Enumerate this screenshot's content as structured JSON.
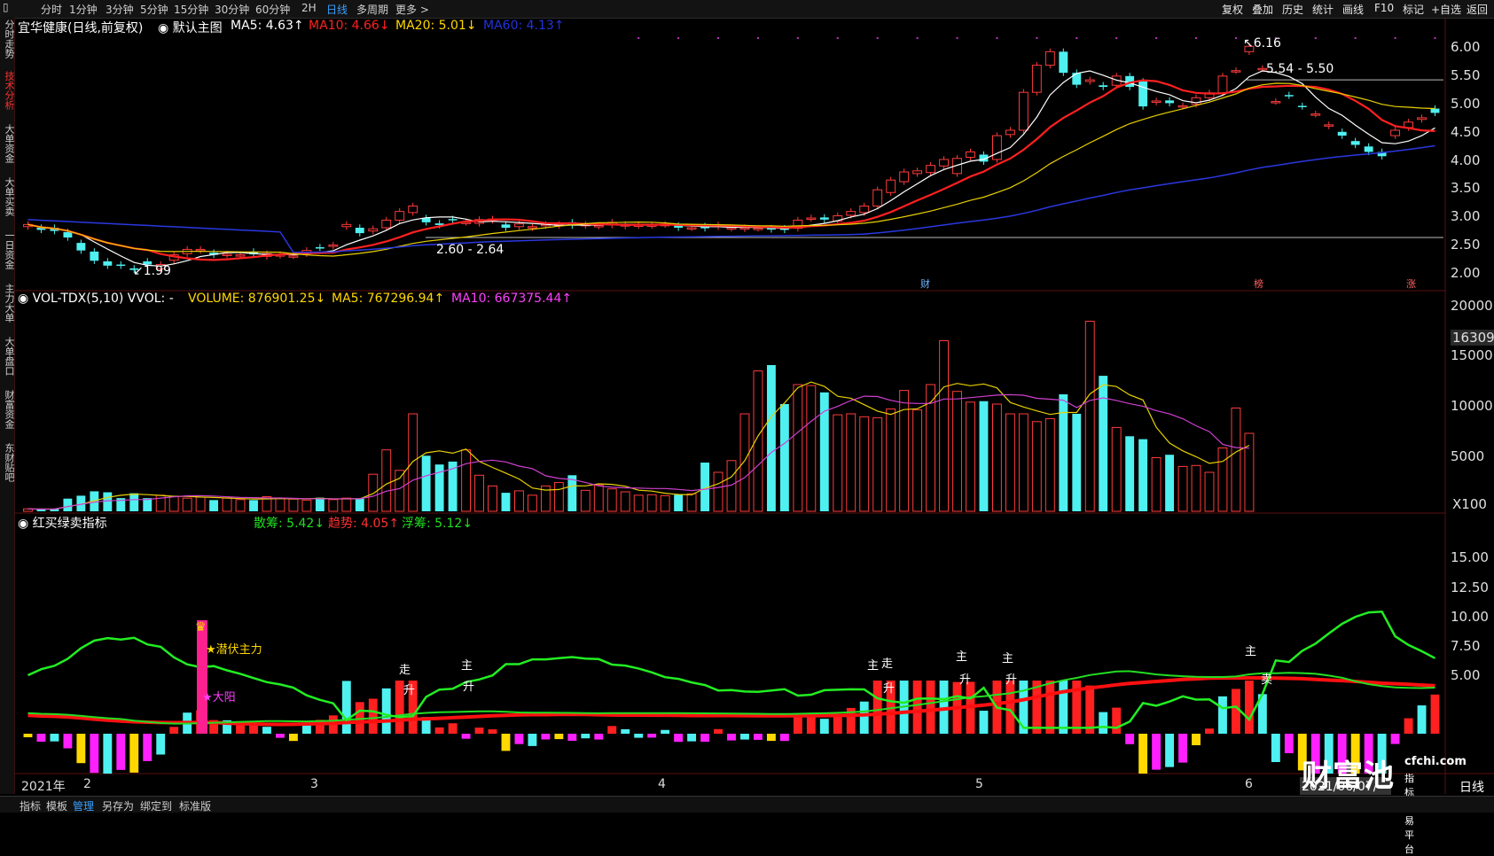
{
  "toolbar": {
    "items": [
      "分时",
      "1分钟",
      "3分钟",
      "5分钟",
      "15分钟",
      "30分钟",
      "60分钟",
      "2H",
      "日线",
      "多周期",
      "更多 >"
    ],
    "active": "日线",
    "right_items": [
      "复权",
      "叠加",
      "历史",
      "统计",
      "画线",
      "F10",
      "标记",
      "+自选",
      "返回"
    ]
  },
  "sidebar": {
    "items": [
      "分时走势",
      "技术分析",
      "大单资金",
      "大单买卖",
      "一日资金",
      "主力大单",
      "大单盘口",
      "财富资金",
      "东财贴吧"
    ],
    "active": "技术分析"
  },
  "main_panel": {
    "stock_name": "宜华健康(日线,前复权)",
    "template_label": "默认主图",
    "indicators": [
      {
        "label": "MA5: 4.63↑",
        "color": "#ffffff"
      },
      {
        "label": "MA10: 4.66↓",
        "color": "#ff2020"
      },
      {
        "label": "MA20: 5.01↓",
        "color": "#ffd800"
      },
      {
        "label": "MA60: 4.13↑",
        "color": "#2233dd"
      }
    ],
    "annotations": {
      "high": "6.16",
      "low": "1.99",
      "range_high": "5.54 - 5.50",
      "range_low": "2.60 - 2.64"
    },
    "events": [
      "财",
      "榜",
      "涨"
    ],
    "yticks": [
      "6.00",
      "5.50",
      "5.00",
      "4.50",
      "4.00",
      "3.50",
      "3.00",
      "2.50",
      "2.00"
    ]
  },
  "volume_panel": {
    "title": "VOL-TDX(5,10) VVOL: -",
    "indicators": [
      {
        "label": "VOLUME: 876901.25↓",
        "color": "#ffd800"
      },
      {
        "label": "MA5: 767296.94↑",
        "color": "#ffd800"
      },
      {
        "label": "MA10: 667375.44↑",
        "color": "#ff40ff"
      }
    ],
    "yticks": [
      "20000",
      "15000",
      "10000",
      "5000"
    ],
    "highlight_value": "16309",
    "unit": "X100"
  },
  "signal_panel": {
    "title": "红买绿卖指标",
    "indicators": [
      {
        "label": "散筹: 5.42↓",
        "color": "#22dd22"
      },
      {
        "label": "趋势: 4.05↑",
        "color": "#ff3030"
      },
      {
        "label": "浮筹: 5.12↓",
        "color": "#22dd22"
      }
    ],
    "labels": {
      "lurking": "★潜伏主力",
      "big_yang": "★大阳",
      "zou": "走",
      "sheng": "升",
      "zhu": "主",
      "mai": "卖"
    },
    "yticks": [
      "15.00",
      "12.50",
      "10.00",
      "7.50",
      "5.00"
    ]
  },
  "date_axis": {
    "start": "2021年",
    "months": [
      "2",
      "3",
      "4",
      "5",
      "6"
    ],
    "cursor_date": "2021/06/07/一",
    "period": "日线"
  },
  "bottom_tabs": {
    "items": [
      "指标",
      "模板",
      "管理",
      "另存为",
      "绑定到",
      "标准版"
    ],
    "active": "管理"
  },
  "watermark": {
    "brand": "财富池",
    "site": "cfchi.com",
    "sub": "指标交易平台"
  },
  "chart_data": {
    "type": "candlestick",
    "dates_hint": "2021-01-13 .. 2021-06-07 (daily)",
    "open": [
      2.82,
      2.8,
      2.8,
      2.72,
      2.52,
      2.36,
      2.18,
      2.12,
      2.05,
      2.18,
      2.04,
      2.2,
      2.32,
      2.38,
      2.34,
      2.3,
      2.3,
      2.36,
      2.27,
      2.29,
      2.28,
      2.32,
      2.44,
      2.46,
      2.82,
      2.8,
      2.74,
      2.8,
      2.94,
      3.08,
      2.98,
      2.88,
      2.96,
      2.9,
      2.88,
      2.94,
      2.86,
      2.82,
      2.8,
      2.84,
      2.84,
      2.9,
      2.84,
      2.83,
      2.85,
      2.83,
      2.84,
      2.84,
      2.86,
      2.84,
      2.8,
      2.83,
      2.82,
      2.79,
      2.78,
      2.79,
      2.79,
      2.79,
      2.79,
      2.97,
      2.99,
      2.92,
      3.03,
      3.08,
      3.2,
      3.45,
      3.65,
      3.8,
      3.82,
      3.94,
      3.8,
      4.1,
      4.15,
      4.06,
      4.52,
      4.6,
      5.3,
      5.8,
      6.05,
      5.66,
      5.5,
      5.43,
      5.43,
      5.6,
      5.5,
      5.12,
      5.15,
      5.05,
      5.08,
      5.2,
      5.29,
      5.7,
      6.05,
      5.74,
      5.13,
      5.25,
      5.05,
      4.9,
      4.68,
      4.57,
      4.4,
      4.3,
      4.2,
      4.5,
      4.65,
      4.8,
      5.0
    ],
    "close": [
      2.86,
      2.76,
      2.74,
      2.62,
      2.38,
      2.19,
      2.1,
      2.1,
      2.02,
      2.12,
      2.12,
      2.3,
      2.4,
      2.4,
      2.3,
      2.31,
      2.3,
      2.31,
      2.32,
      2.3,
      2.28,
      2.38,
      2.43,
      2.48,
      2.86,
      2.7,
      2.78,
      2.94,
      3.1,
      3.2,
      2.9,
      2.85,
      2.94,
      2.9,
      2.95,
      2.96,
      2.8,
      2.87,
      2.82,
      2.86,
      2.86,
      2.84,
      2.86,
      2.84,
      2.9,
      2.86,
      2.85,
      2.85,
      2.86,
      2.8,
      2.8,
      2.79,
      2.85,
      2.8,
      2.8,
      2.79,
      2.77,
      2.76,
      2.94,
      2.98,
      2.95,
      3.02,
      3.1,
      3.2,
      3.5,
      3.68,
      3.83,
      3.85,
      3.95,
      4.06,
      4.08,
      4.2,
      4.02,
      4.5,
      4.6,
      5.3,
      5.8,
      6.05,
      5.66,
      5.44,
      5.53,
      5.4,
      5.6,
      5.4,
      5.04,
      5.14,
      5.1,
      5.05,
      5.2,
      5.29,
      5.6,
      5.7,
      6.15,
      5.74,
      5.13,
      5.24,
      5.04,
      4.9,
      4.7,
      4.5,
      4.33,
      4.2,
      4.12,
      4.6,
      4.75,
      4.83,
      4.92
    ],
    "volume": [
      250,
      200,
      230,
      1300,
      1600,
      2050,
      1950,
      1350,
      1850,
      1350,
      1650,
      1500,
      1350,
      1450,
      1150,
      1350,
      1200,
      1150,
      1500,
      1350,
      1250,
      1150,
      1400,
      1200,
      1350,
      1300,
      3800,
      6300,
      4200,
      10000,
      5700,
      4800,
      5100,
      6300,
      3700,
      2600,
      1900,
      2100,
      1650,
      2600,
      2950,
      3700,
      2150,
      2700,
      2300,
      2000,
      1650,
      1700,
      1600,
      1700,
      1800,
      5000,
      4000,
      5200,
      10000,
      14400,
      15000,
      11000,
      13000,
      12900,
      12200,
      9900,
      10000,
      9700,
      9600,
      10500,
      12400,
      10400,
      13000,
      17500,
      12300,
      11200,
      11300,
      11000,
      10000,
      10000,
      9200,
      9500,
      12000,
      10000,
      19500,
      13900,
      8600,
      7700,
      7400,
      5500,
      5800,
      4600,
      4700,
      4000,
      6500,
      10600,
      8000
    ],
    "volume_colors_note": "cyan = down day, red outline = up day"
  }
}
